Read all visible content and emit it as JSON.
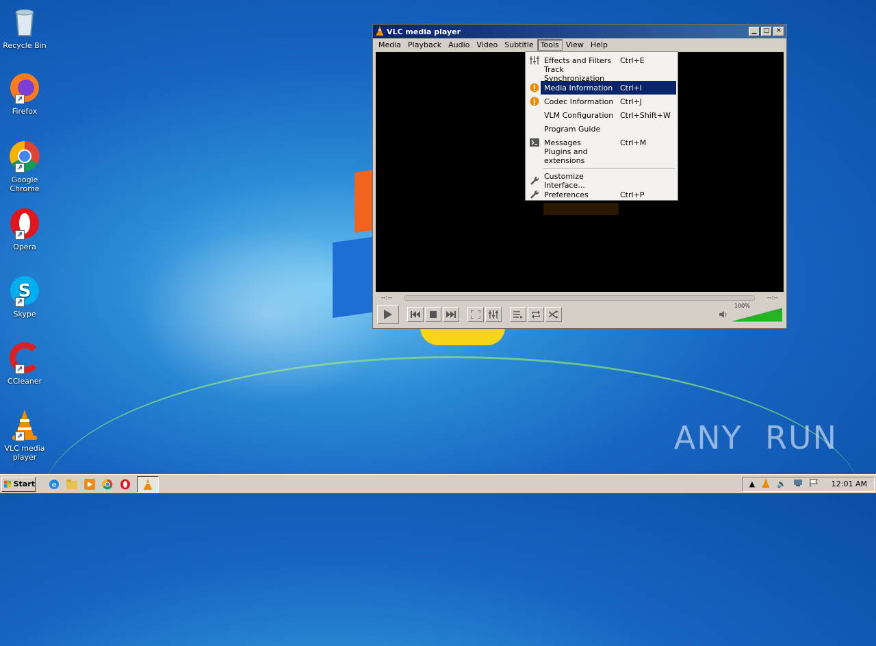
{
  "desktop": {
    "icons": [
      {
        "label": "Recycle Bin",
        "icon": "recycle-bin-icon"
      },
      {
        "label": "Firefox",
        "icon": "firefox-icon"
      },
      {
        "label": "Google Chrome",
        "icon": "chrome-icon"
      },
      {
        "label": "Opera",
        "icon": "opera-icon"
      },
      {
        "label": "Skype",
        "icon": "skype-icon"
      },
      {
        "label": "CCleaner",
        "icon": "ccleaner-icon"
      },
      {
        "label": "VLC media player",
        "icon": "vlc-icon"
      }
    ],
    "watermark": "ANY  RUN"
  },
  "vlc": {
    "title": "VLC media player",
    "menu": [
      "Media",
      "Playback",
      "Audio",
      "Video",
      "Subtitle",
      "Tools",
      "View",
      "Help"
    ],
    "open_menu": "Tools",
    "tools_menu": [
      {
        "label": "Effects and Filters",
        "shortcut": "Ctrl+E",
        "icon": "equalizer-icon"
      },
      {
        "label": "Track Synchronization",
        "shortcut": "",
        "icon": ""
      },
      {
        "label": "Media Information",
        "shortcut": "Ctrl+I",
        "icon": "info-icon",
        "highlighted": true
      },
      {
        "label": "Codec Information",
        "shortcut": "Ctrl+J",
        "icon": "info-icon"
      },
      {
        "label": "VLM Configuration",
        "shortcut": "Ctrl+Shift+W",
        "icon": ""
      },
      {
        "label": "Program Guide",
        "shortcut": "",
        "icon": ""
      },
      {
        "label": "Messages",
        "shortcut": "Ctrl+M",
        "icon": "terminal-icon"
      },
      {
        "label": "Plugins and extensions",
        "shortcut": "",
        "icon": ""
      },
      {
        "label": "Customize Interface...",
        "shortcut": "",
        "icon": "wrench-icon"
      },
      {
        "label": "Preferences",
        "shortcut": "Ctrl+P",
        "icon": "wrench-icon"
      }
    ],
    "time_elapsed": "--:--",
    "time_total": "--:--",
    "volume_label": "100%",
    "volume_level": 1.0
  },
  "taskbar": {
    "start_label": "Start",
    "clock": "12:01 AM"
  },
  "colors": {
    "menu_highlight": "#0a246a",
    "title_gradient_start": "#0a246a",
    "title_gradient_end": "#3a6ea5",
    "vlc_orange": "#f28b00",
    "volume_green": "#22b422"
  }
}
